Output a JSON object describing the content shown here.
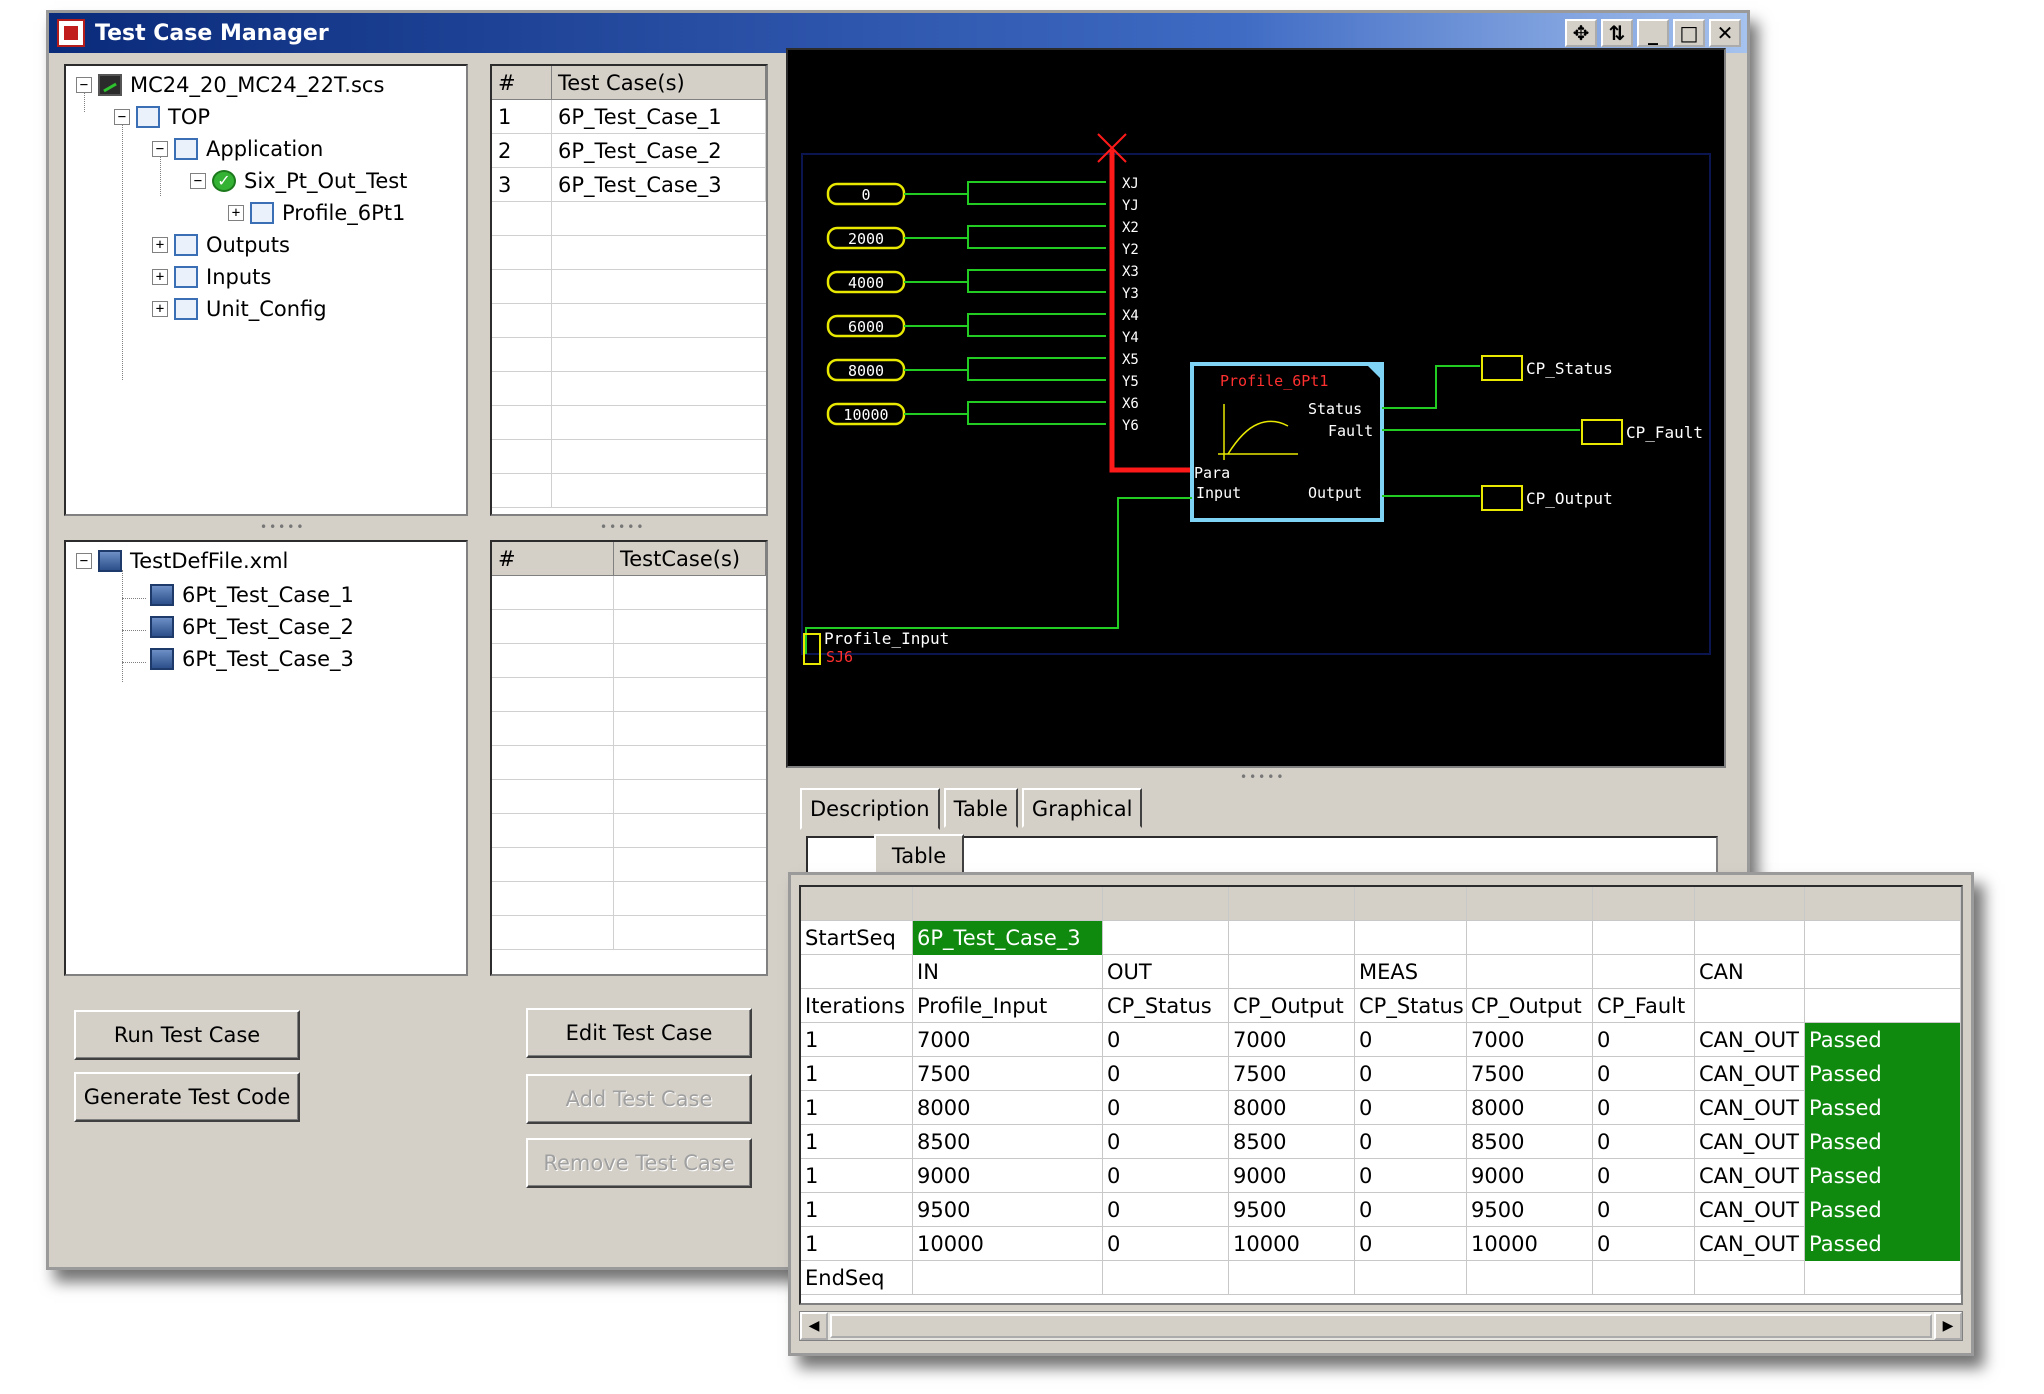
{
  "window": {
    "title": "Test Case Manager",
    "controls": [
      "✥",
      "⇅",
      "_",
      "□",
      "✕"
    ]
  },
  "project_tree": {
    "root": "MC24_20_MC24_22T.scs",
    "top": "TOP",
    "application": "Application",
    "test": "Six_Pt_Out_Test",
    "profile": "Profile_6Pt1",
    "outputs": "Outputs",
    "inputs": "Inputs",
    "unit_config": "Unit_Config"
  },
  "test_list": {
    "headers": [
      "#",
      "Test Case(s)"
    ],
    "rows": [
      {
        "num": "1",
        "name": "6P_Test_Case_1"
      },
      {
        "num": "2",
        "name": "6P_Test_Case_2"
      },
      {
        "num": "3",
        "name": "6P_Test_Case_3"
      }
    ]
  },
  "def_tree": {
    "root": "TestDefFile.xml",
    "items": [
      "6Pt_Test_Case_1",
      "6Pt_Test_Case_2",
      "6Pt_Test_Case_3"
    ]
  },
  "def_list": {
    "headers": [
      "#",
      "TestCase(s)"
    ]
  },
  "buttons": {
    "run": "Run Test Case",
    "generate": "Generate Test Code",
    "edit": "Edit Test Case",
    "add": "Add Test Case",
    "remove": "Remove Test Case"
  },
  "diagram": {
    "inputs": [
      "0",
      "2000",
      "4000",
      "6000",
      "8000",
      "10000"
    ],
    "pins": [
      "XJ",
      "YJ",
      "X2",
      "Y2",
      "X3",
      "Y3",
      "X4",
      "Y4",
      "X5",
      "Y5",
      "X6",
      "Y6"
    ],
    "block_title": "Profile_6Pt1",
    "block_ports": {
      "status": "Status",
      "fault": "Fault",
      "para": "Para",
      "input": "Input",
      "output": "Output"
    },
    "outputs": [
      "CP_Status",
      "CP_Fault",
      "CP_Output"
    ],
    "input_tag": "Profile_Input",
    "input_tag_sub": "SJ6"
  },
  "tabs": [
    "Description",
    "Table",
    "Graphical"
  ],
  "inner_tab": "Table",
  "table": {
    "startseq": "StartSeq",
    "startseq_value": "6P_Test_Case_3",
    "groups": [
      "IN",
      "OUT",
      "MEAS",
      "CAN"
    ],
    "columns": [
      "Iterations",
      "Profile_Input",
      "CP_Status",
      "CP_Output",
      "CP_Status",
      "CP_Output",
      "CP_Fault"
    ],
    "rows": [
      [
        "1",
        "7000",
        "0",
        "7000",
        "0",
        "7000",
        "0",
        "CAN_OUT",
        "Passed"
      ],
      [
        "1",
        "7500",
        "0",
        "7500",
        "0",
        "7500",
        "0",
        "CAN_OUT",
        "Passed"
      ],
      [
        "1",
        "8000",
        "0",
        "8000",
        "0",
        "8000",
        "0",
        "CAN_OUT",
        "Passed"
      ],
      [
        "1",
        "8500",
        "0",
        "8500",
        "0",
        "8500",
        "0",
        "CAN_OUT",
        "Passed"
      ],
      [
        "1",
        "9000",
        "0",
        "9000",
        "0",
        "9000",
        "0",
        "CAN_OUT",
        "Passed"
      ],
      [
        "1",
        "9500",
        "0",
        "9500",
        "0",
        "9500",
        "0",
        "CAN_OUT",
        "Passed"
      ],
      [
        "1",
        "10000",
        "0",
        "10000",
        "0",
        "10000",
        "0",
        "CAN_OUT",
        "Passed"
      ]
    ],
    "endseq": "EndSeq"
  }
}
